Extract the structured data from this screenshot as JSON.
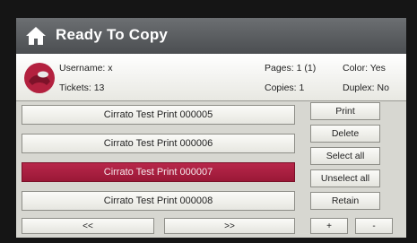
{
  "title": "Ready To Copy",
  "icons": {
    "home": "home-icon",
    "user": "user-avatar-icon"
  },
  "colors": {
    "accent": "#a51d3f",
    "titlebar": "#5a5d60"
  },
  "info": {
    "username": "Username: x",
    "tickets": "Tickets: 13",
    "pages": "Pages: 1 (1)",
    "copies": "Copies: 1",
    "color": "Color: Yes",
    "duplex": "Duplex: No"
  },
  "jobs": [
    "Cirrato Test Print 000005",
    "Cirrato Test Print 000006",
    "Cirrato Test Print 000007",
    "Cirrato Test Print 000008"
  ],
  "selected_job": "Cirrato Test Print 000007",
  "actions": {
    "print": "Print",
    "delete": "Delete",
    "select_all": "Select all",
    "unselect_all": "Unselect all",
    "retain": "Retain"
  },
  "nav": {
    "prev": "<<",
    "next": ">>",
    "plus": "+",
    "minus": "-"
  }
}
